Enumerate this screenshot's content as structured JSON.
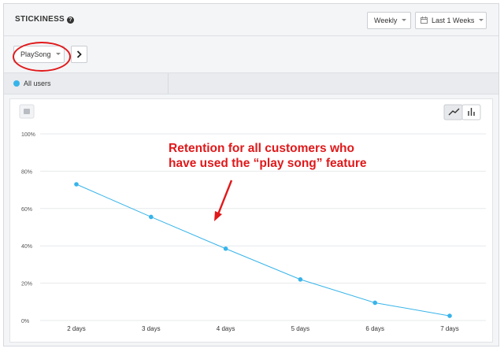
{
  "header": {
    "title": "STICKINESS",
    "help_icon": "?"
  },
  "controls": {
    "interval": "Weekly",
    "range": "Last 1 Weeks"
  },
  "toolbar": {
    "event": "PlaySong"
  },
  "series_bar": {
    "label": "All users",
    "color": "#37b4ea"
  },
  "annotation": {
    "line1": "Retention for all customers who",
    "line2": "have used the “play song” feature",
    "color": "#e0191b"
  },
  "chart_data": {
    "type": "line",
    "categories": [
      "2 days",
      "3 days",
      "4 days",
      "5 days",
      "6 days",
      "7 days"
    ],
    "series": [
      {
        "values": [
          73,
          55.5,
          38.5,
          22,
          9.5,
          2.5
        ]
      }
    ],
    "yticks": [
      "0%",
      "20%",
      "40%",
      "60%",
      "80%",
      "100%"
    ],
    "ylim": [
      0,
      100
    ],
    "grid": true,
    "line_color": "#37b4ea"
  }
}
